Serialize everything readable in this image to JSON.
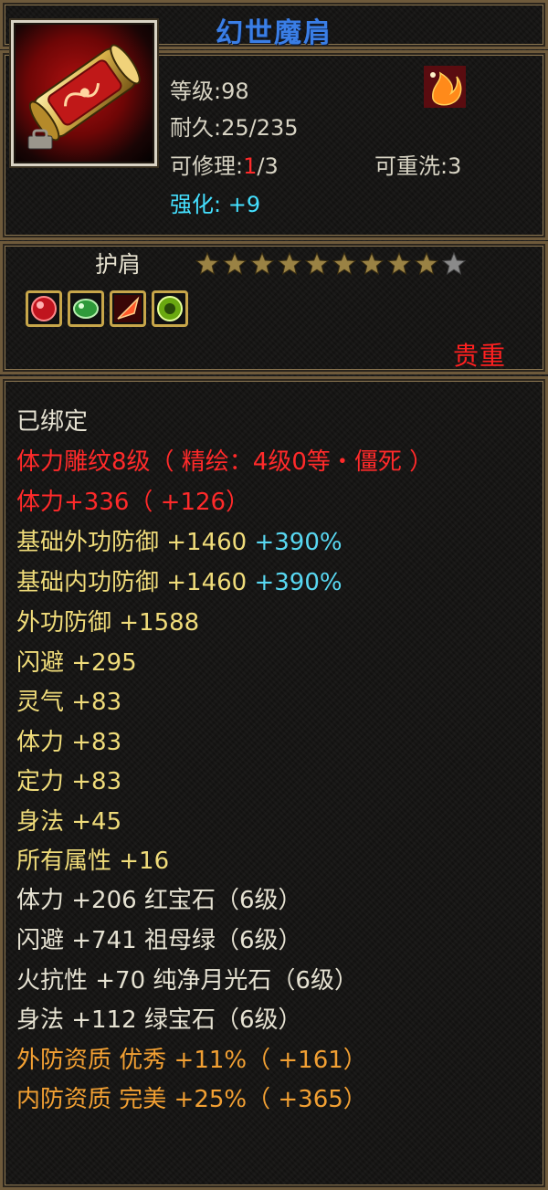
{
  "item": {
    "name": "幻世魔肩",
    "level_label": "等级:98",
    "durability_label": "耐久:25/235",
    "repair_prefix": "可修理:",
    "repair_current": "1",
    "repair_suffix": "/3",
    "rewash_label": "可重洗:3",
    "enhance_label": "强化: +9",
    "type": "护肩",
    "stars_filled": 9,
    "stars_total": 10,
    "quality": "贵重"
  },
  "gems": [
    {
      "name": "red-gem-icon",
      "color": "#d8202a"
    },
    {
      "name": "green-gem-icon",
      "color": "#3aa83a"
    },
    {
      "name": "fire-gem-icon",
      "color": "#e0502a"
    },
    {
      "name": "lime-gem-icon",
      "color": "#7cc01a"
    }
  ],
  "stats": {
    "bound": "已绑定",
    "engrave": "体力雕纹8级（ 精绘：4级0等・僵死 ）",
    "stamina_bonus": "体力+336（ +126）",
    "base_ext_def_label": "基础外功防御 +1460 ",
    "base_ext_def_pct": "+390%",
    "base_int_def_label": "基础内功防御 +1460 ",
    "base_int_def_pct": "+390%",
    "ext_def": "外功防御 +1588",
    "dodge": "闪避 +295",
    "spirit": "灵气 +83",
    "stamina": "体力 +83",
    "focus": "定力 +83",
    "agility": "身法 +45",
    "all_attr": "所有属性 +16",
    "gem1": "体力 +206 红宝石（6级）",
    "gem2": "闪避 +741 祖母绿（6级）",
    "gem3": "火抗性 +70 纯净月光石（6级）",
    "gem4": "身法 +112 绿宝石（6级）",
    "ext_quality": "外防资质 优秀 +11%（ +161）",
    "int_quality": "内防资质 完美 +25%（ +365）"
  },
  "colors": {
    "title": "#3a7ee6",
    "red": "#ff2a2a",
    "cyan": "#58d8f2",
    "yellow": "#f0dc7a",
    "orange": "#f2a033",
    "white": "#e6e2d2"
  }
}
